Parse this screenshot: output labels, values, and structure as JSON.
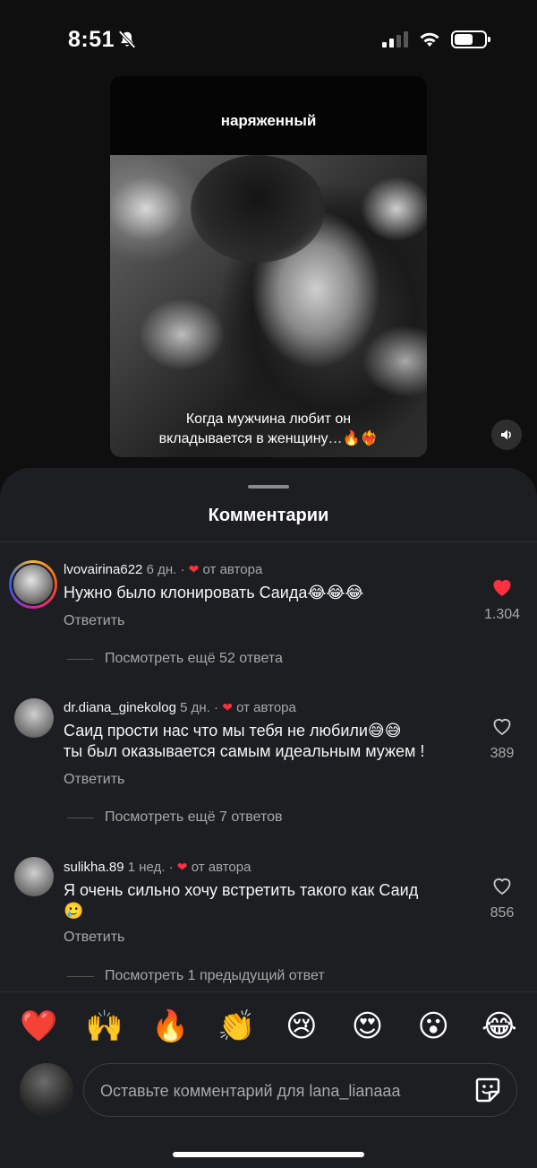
{
  "status": {
    "time": "8:51",
    "battery_level": 0.62
  },
  "story": {
    "title": "наряженный",
    "caption_line1": "Когда мужчина любит он",
    "caption_line2": "вкладывается в женщину…🔥❤️‍🔥"
  },
  "sheet": {
    "title": "Комментарии"
  },
  "comments": [
    {
      "user": "lvovairina622",
      "age": "6 дн.",
      "author_tag": "от автора",
      "text": "Нужно было клонировать Саида😂😂😂",
      "reply": "Ответить",
      "likes": "1.304",
      "liked": true,
      "more": "Посмотреть ещё 52 ответа"
    },
    {
      "user": "dr.diana_ginekolog",
      "age": "5 дн.",
      "author_tag": "от автора",
      "text_line1": "Саид прости нас что мы тебя не любили😅😅",
      "text_line2": "ты был оказывается самым идеальным мужем !",
      "reply": "Ответить",
      "likes": "389",
      "liked": false,
      "more": "Посмотреть ещё 7 ответов"
    },
    {
      "user": "sulikha.89",
      "age": "1 нед.",
      "author_tag": "от автора",
      "text_line1": "Я очень сильно хочу встретить такого как Саид",
      "text_line2": "🥲",
      "reply": "Ответить",
      "likes": "856",
      "liked": false,
      "more": "Посмотреть 1 предыдущий ответ"
    }
  ],
  "quick_reactions": [
    "❤️",
    "🙌",
    "🔥",
    "👏",
    "😢",
    "😍",
    "😮",
    "😂"
  ],
  "compose": {
    "placeholder": "Оставьте комментарий для lana_lianaaa"
  },
  "colors": {
    "like_red": "#ff3040",
    "sheet_bg": "#1c1e22",
    "muted_text": "#a8a8a8"
  },
  "icons": [
    "bell-slash-icon",
    "signal-icon",
    "wifi-icon",
    "battery-icon",
    "speaker-icon",
    "heart-icon",
    "sticker-icon"
  ]
}
